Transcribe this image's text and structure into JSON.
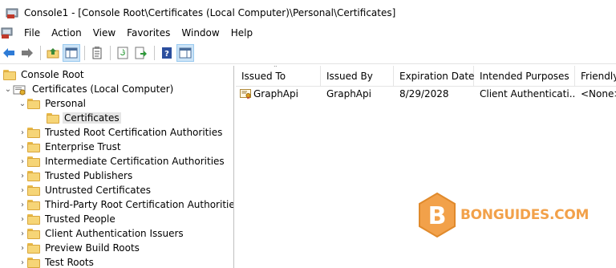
{
  "window": {
    "title": "Console1 - [Console Root\\Certificates (Local Computer)\\Personal\\Certificates]"
  },
  "menubar": {
    "items": [
      "File",
      "Action",
      "View",
      "Favorites",
      "Window",
      "Help"
    ]
  },
  "toolbar": {
    "buttons": [
      "back-icon",
      "forward-icon",
      "up-folder-icon",
      "show-hide-tree-icon",
      "properties-icon",
      "refresh-icon",
      "export-list-icon",
      "help-icon",
      "show-hide-action-pane-icon"
    ]
  },
  "tree": {
    "root": "Console Root",
    "store": "Certificates (Local Computer)",
    "personal": "Personal",
    "certificates": "Certificates",
    "children": [
      "Trusted Root Certification Authorities",
      "Enterprise Trust",
      "Intermediate Certification Authorities",
      "Trusted Publishers",
      "Untrusted Certificates",
      "Third-Party Root Certification Authorities",
      "Trusted People",
      "Client Authentication Issuers",
      "Preview Build Roots",
      "Test Roots"
    ]
  },
  "list": {
    "columns": [
      "Issued To",
      "Issued By",
      "Expiration Date",
      "Intended Purposes",
      "Friendly"
    ],
    "rows": [
      [
        "GraphApi",
        "GraphApi",
        "8/29/2028",
        "Client Authenticati...",
        "<None>"
      ]
    ]
  },
  "watermark": {
    "letter": "B",
    "text": "BONGUIDES.COM",
    "color": "#f2a14a"
  },
  "colors": {
    "selection": "#e5e5e5",
    "folder": "#f6d577",
    "toolbar_active": "#cce4f7"
  }
}
